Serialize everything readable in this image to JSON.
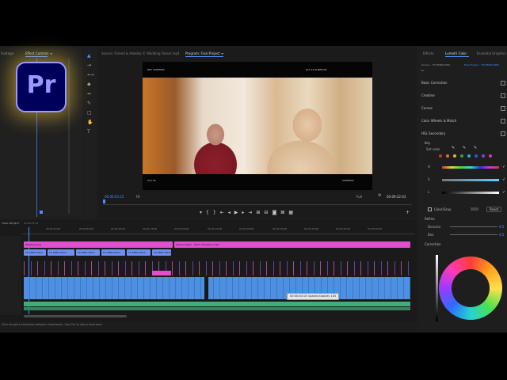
{
  "logo": {
    "text": "Pr"
  },
  "effect_controls": {
    "tab_prefix": "Footage",
    "tab_active": "Effect Controls",
    "tab_menu": "≡"
  },
  "source_monitor": {
    "tab": "Source: Fareed & Adeeba © Wedding Teaser.mp4"
  },
  "program_monitor": {
    "tab": "Program: Final Project",
    "tab_menu": "≡",
    "timecode_current": "00:00:03:15",
    "fit_label": "Fit",
    "quality_label": "Full",
    "timecode_duration": "00:09:22:03"
  },
  "video_overlay": {
    "top_left": "REC  SUPERON",
    "top_right": "010  16   SUPERON",
    "bottom_left": "010  16",
    "bottom_right": "SUPERON"
  },
  "transport": {
    "buttons": [
      "marker",
      "in",
      "out",
      "go-to-in",
      "step-back",
      "play",
      "step-forward",
      "go-to-out",
      "insert",
      "overwrite",
      "camera",
      "compare",
      "settings"
    ]
  },
  "lumetri": {
    "tabs": [
      "Effects",
      "Lumetri Color",
      "Essential Graphics"
    ],
    "source_label": "Source · 73745894.MOV",
    "project_label": "Final Project · 73745894.MOV",
    "fx": "fx",
    "sections": [
      "Basic Correction",
      "Creative",
      "Curves",
      "Color Wheels & Match",
      "HSL Secondary"
    ],
    "key_label": "Key",
    "set_color_label": "Set color",
    "slider_labels": [
      "H",
      "S",
      "L"
    ],
    "color_gray_label": "Color/Gray",
    "reset_label": "Reset",
    "refine_label": "Refine",
    "denoise_label": "Denoise",
    "denoise_value": "0.0",
    "blur_label": "Blur",
    "blur_value": "0.0",
    "correction_label": "Correction",
    "swatches": [
      "#c2392b",
      "#d67a1f",
      "#d4c21e",
      "#3aa33a",
      "#2bb6b6",
      "#2e5ad4",
      "#8a3fd0",
      "#cc3fa8"
    ]
  },
  "timeline": {
    "sequence_name": "FINAL PROJECT",
    "timecode": "00:00:03:15",
    "ruler": [
      "00:00:00:00",
      "00:00:20:00",
      "00:00:45:00",
      "00:01:00:00",
      "00:01:15:00",
      "00:01:30:00",
      "00:01:45:00",
      "00:02:00:00",
      "00:02:15:00",
      "00:02:30:00",
      "00:02:45:00",
      "00:03:00:00"
    ],
    "track_labels": [
      "V5",
      "V4",
      "V3",
      "V2",
      "V1",
      "A1",
      "A2"
    ],
    "clip_v5_a": "Wedding.png",
    "clip_v5_b": "Teleprompter · Glitch Transition.mp4",
    "v4_clips": [
      "FX  FREE Glitch",
      "FX  FREE Glitch",
      "FX  FREE Glitch",
      "FX  FREE Glitch",
      "FX  FREE Glitch",
      "FX  FREE Glitch",
      "FX  FREE Glitch"
    ],
    "tooltip": "00:00:00:10  Opacity:Opacity 100",
    "status": "Click to add a keyframe between keyframes. Use Ctrl to add a keyframe."
  }
}
